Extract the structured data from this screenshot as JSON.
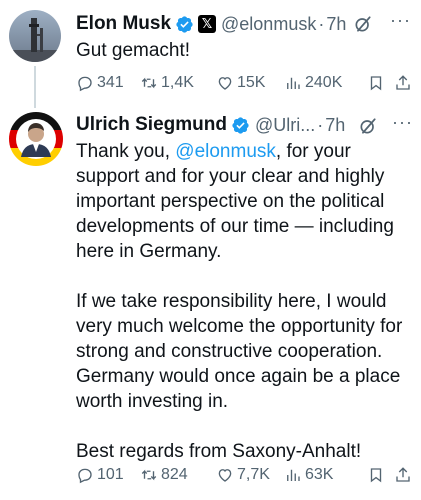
{
  "tweets": [
    {
      "name": "Elon Musk",
      "handle": "@elonmusk",
      "separator": "·",
      "time": "7h",
      "text": "Gut gemacht!",
      "stats": {
        "replies": "341",
        "reposts": "1,4K",
        "likes": "15K",
        "views": "240K"
      }
    },
    {
      "name": "Ulrich Siegmund",
      "handle": "@Ulri...",
      "separator": "·",
      "time": "7h",
      "text_before": "Thank you, ",
      "mention": "@elonmusk",
      "text_after": ", for your support and for your clear and highly important perspective on the political developments of our time — including here in Germany.\n\nIf we take responsibility here, I would very much welcome the opportunity for strong and constructive cooperation. Germany would once again be a place worth investing in.\n\nBest regards from Saxony-Anhalt!",
      "stats": {
        "replies": "101",
        "reposts": "824",
        "likes": "7,7K",
        "views": "63K"
      }
    }
  ],
  "colors": {
    "link": "#1d9bf0",
    "muted": "#536471",
    "verified": "#1d9bf0",
    "text": "#0f1419"
  },
  "icons": [
    "reply-icon",
    "repost-icon",
    "like-icon",
    "views-icon",
    "bookmark-icon",
    "share-icon",
    "grok-icon",
    "more-icon",
    "verified-icon"
  ]
}
